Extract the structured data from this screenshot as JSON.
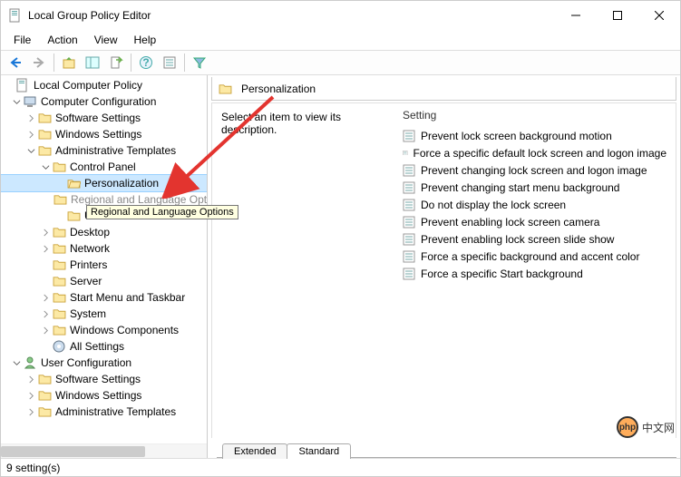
{
  "window": {
    "title": "Local Group Policy Editor"
  },
  "menubar": [
    "File",
    "Action",
    "View",
    "Help"
  ],
  "tree": {
    "root": "Local Computer Policy",
    "computerConfig": "Computer Configuration",
    "softwareSettings": "Software Settings",
    "windowsSettings": "Windows Settings",
    "adminTemplates": "Administrative Templates",
    "controlPanel": "Control Panel",
    "personalization": "Personalization",
    "regional": "Regional and Language Options",
    "userAccounts": "User Accounts",
    "desktop": "Desktop",
    "network": "Network",
    "printers": "Printers",
    "server": "Server",
    "startMenu": "Start Menu and Taskbar",
    "system": "System",
    "winComponents": "Windows Components",
    "allSettings": "All Settings",
    "userConfig": "User Configuration",
    "uSoftware": "Software Settings",
    "uWindows": "Windows Settings",
    "uAdmin": "Administrative Templates"
  },
  "detail": {
    "headerTitle": "Personalization",
    "description": "Select an item to view its description.",
    "settingHeader": "Setting",
    "items": [
      "Prevent lock screen background motion",
      "Force a specific default lock screen and logon image",
      "Prevent changing lock screen and logon image",
      "Prevent changing start menu background",
      "Do not display the lock screen",
      "Prevent enabling lock screen camera",
      "Prevent enabling lock screen slide show",
      "Force a specific background and accent color",
      "Force a specific Start background"
    ]
  },
  "tabs": {
    "extended": "Extended",
    "standard": "Standard"
  },
  "tooltip": "Regional and Language Options",
  "statusbar": "9 setting(s)",
  "watermark": "中文网"
}
